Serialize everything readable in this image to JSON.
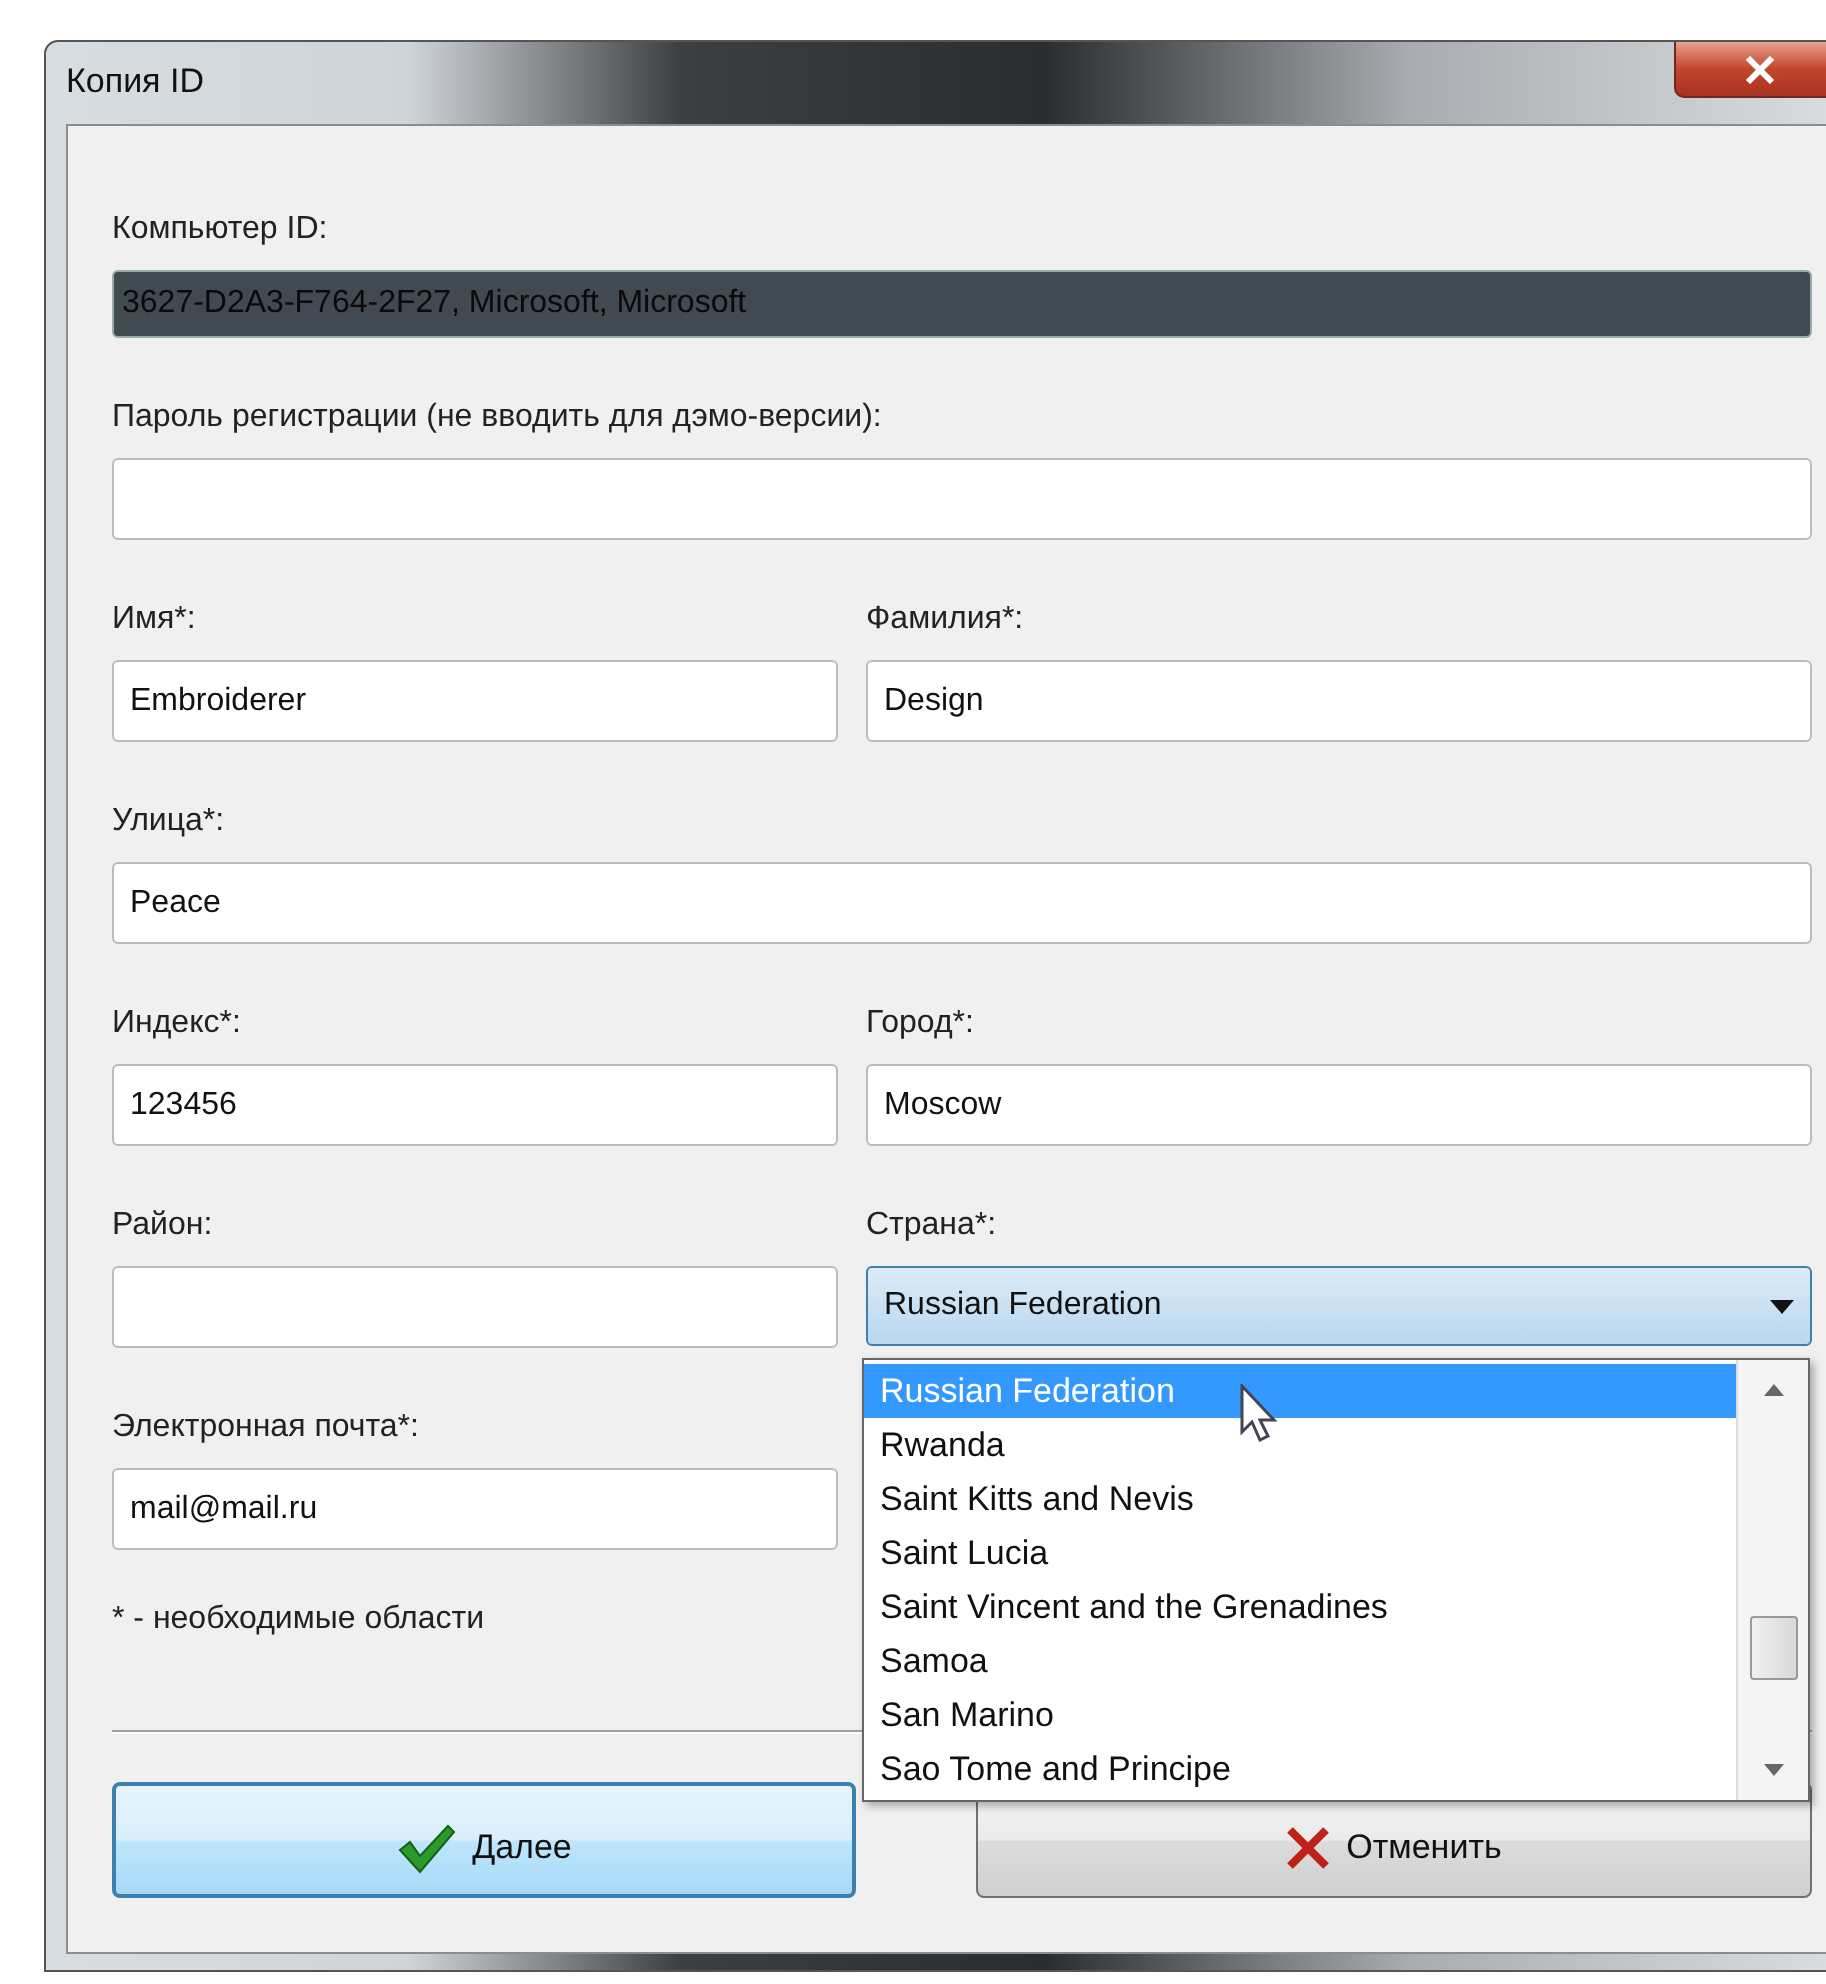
{
  "window": {
    "title": "Копия ID"
  },
  "rows": [
    {
      "kind": "full",
      "fields": [
        {
          "kind": "readonly",
          "label": "Компьютер ID:",
          "value": "3627-D2A3-F764-2F27, Microsoft, Microsoft"
        }
      ]
    },
    {
      "kind": "full",
      "fields": [
        {
          "kind": "text",
          "label": "Пароль регистрации (не вводить для дэмо-версии):"
        }
      ]
    },
    {
      "kind": "split",
      "fields": [
        {
          "kind": "text",
          "label": "Имя*:",
          "value": "Embroiderer"
        },
        {
          "kind": "text",
          "label": "Фамилия*:",
          "value": "Design"
        }
      ]
    },
    {
      "kind": "full",
      "fields": [
        {
          "kind": "text",
          "label": "Улица*:",
          "value": "Peace"
        }
      ]
    },
    {
      "kind": "split",
      "fields": [
        {
          "kind": "text",
          "label": "Индекс*:",
          "value": "123456"
        },
        {
          "kind": "text",
          "label": "Город*:",
          "value": "Moscow"
        }
      ]
    },
    {
      "kind": "split",
      "fields": [
        {
          "kind": "text",
          "label": "Район:"
        },
        {
          "kind": "dropdown",
          "label": "Страна*:",
          "value": "Russian Federation",
          "expanded": true,
          "options": [
            {
              "label": "Russian Federation",
              "selected": true
            },
            {
              "label": "Rwanda",
              "selected": false
            },
            {
              "label": "Saint Kitts and Nevis",
              "selected": false
            },
            {
              "label": "Saint Lucia",
              "selected": false
            },
            {
              "label": "Saint Vincent and the Grenadines",
              "selected": false
            },
            {
              "label": "Samoa",
              "selected": false
            },
            {
              "label": "San Marino",
              "selected": false
            },
            {
              "label": "Sao Tome and Principe",
              "selected": false
            }
          ]
        }
      ]
    },
    {
      "kind": "split",
      "fields": [
        {
          "kind": "text",
          "label": "Электронная почта*:",
          "value": "mail@mail.ru"
        }
      ]
    }
  ],
  "note": "* - необходимые области",
  "buttons": [
    {
      "kind": "ok",
      "label": "Далее",
      "focused": true
    },
    {
      "kind": "cancel",
      "label": "Отменить",
      "focused": false
    }
  ]
}
